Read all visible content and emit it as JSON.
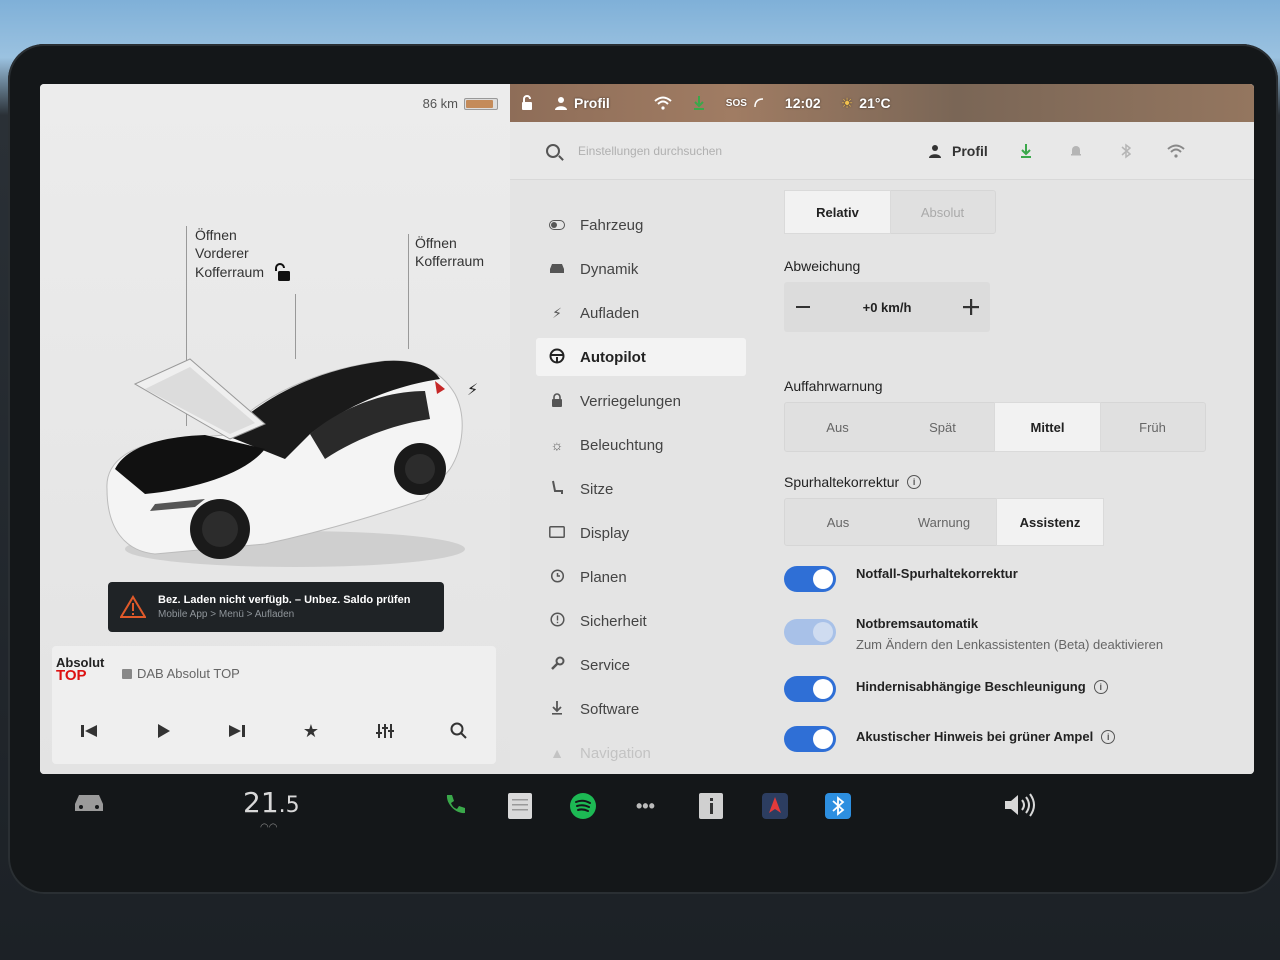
{
  "status": {
    "range": "86 km",
    "battery_level": 0.9,
    "profile": "Profil",
    "sos": "SOS",
    "time": "12:02",
    "temperature": "21°C"
  },
  "car": {
    "frunk_callout_1": "Öffnen",
    "frunk_callout_2": "Vorderer",
    "frunk_callout_3": "Kofferraum",
    "trunk_callout_1": "Öffnen",
    "trunk_callout_2": "Kofferraum"
  },
  "alert": {
    "title": "Bez. Laden nicht verfügb. – Unbez. Saldo prüfen",
    "subtitle": "Mobile App > Menü > Aufladen"
  },
  "media": {
    "logo_line1": "Absolut",
    "logo_line2": "TOP",
    "station": "DAB Absolut TOP"
  },
  "topbar": {
    "search_placeholder": "Einstellungen durchsuchen",
    "profile": "Profil"
  },
  "menu": {
    "items": [
      {
        "label": "Fahrzeug",
        "icon": "toggle-icon"
      },
      {
        "label": "Dynamik",
        "icon": "car-icon"
      },
      {
        "label": "Aufladen",
        "icon": "bolt-icon"
      },
      {
        "label": "Autopilot",
        "icon": "steering-wheel-icon"
      },
      {
        "label": "Verriegelungen",
        "icon": "lock-icon"
      },
      {
        "label": "Beleuchtung",
        "icon": "sun-icon"
      },
      {
        "label": "Sitze",
        "icon": "seat-icon"
      },
      {
        "label": "Display",
        "icon": "display-icon"
      },
      {
        "label": "Planen",
        "icon": "clock-icon"
      },
      {
        "label": "Sicherheit",
        "icon": "alert-circle-icon"
      },
      {
        "label": "Service",
        "icon": "wrench-icon"
      },
      {
        "label": "Software",
        "icon": "download-icon"
      },
      {
        "label": "Navigation",
        "icon": "navigation-icon"
      }
    ]
  },
  "settings": {
    "speed_mode": {
      "options": [
        "Relativ",
        "Absolut"
      ],
      "selected": "Relativ"
    },
    "offset_label": "Abweichung",
    "offset_value": "+0 km/h",
    "collision_label": "Auffahrwarnung",
    "collision": {
      "options": [
        "Aus",
        "Spät",
        "Mittel",
        "Früh"
      ],
      "selected": "Mittel"
    },
    "lane_label": "Spurhaltekorrektur",
    "lane": {
      "options": [
        "Aus",
        "Warnung",
        "Assistenz"
      ],
      "selected": "Assistenz"
    },
    "toggles": [
      {
        "title": "Notfall-Spurhaltekorrektur",
        "subtitle": "",
        "on": true,
        "disabled": false,
        "info": false
      },
      {
        "title": "Notbremsautomatik",
        "subtitle": "Zum Ändern den Lenkassistenten (Beta) deaktivieren",
        "on": true,
        "disabled": true,
        "info": false
      },
      {
        "title": "Hindernisabhängige Beschleunigung",
        "subtitle": "",
        "on": true,
        "disabled": false,
        "info": true
      },
      {
        "title": "Akustischer Hinweis bei grüner Ampel",
        "subtitle": "",
        "on": true,
        "disabled": false,
        "info": true
      }
    ]
  },
  "dock": {
    "temperature_whole": "21",
    "temperature_decimal": ".5"
  },
  "colors": {
    "accent": "#2f6fd6",
    "phone": "#3aa84a",
    "spotify": "#1db954",
    "bluetooth": "#2d8fe0"
  }
}
